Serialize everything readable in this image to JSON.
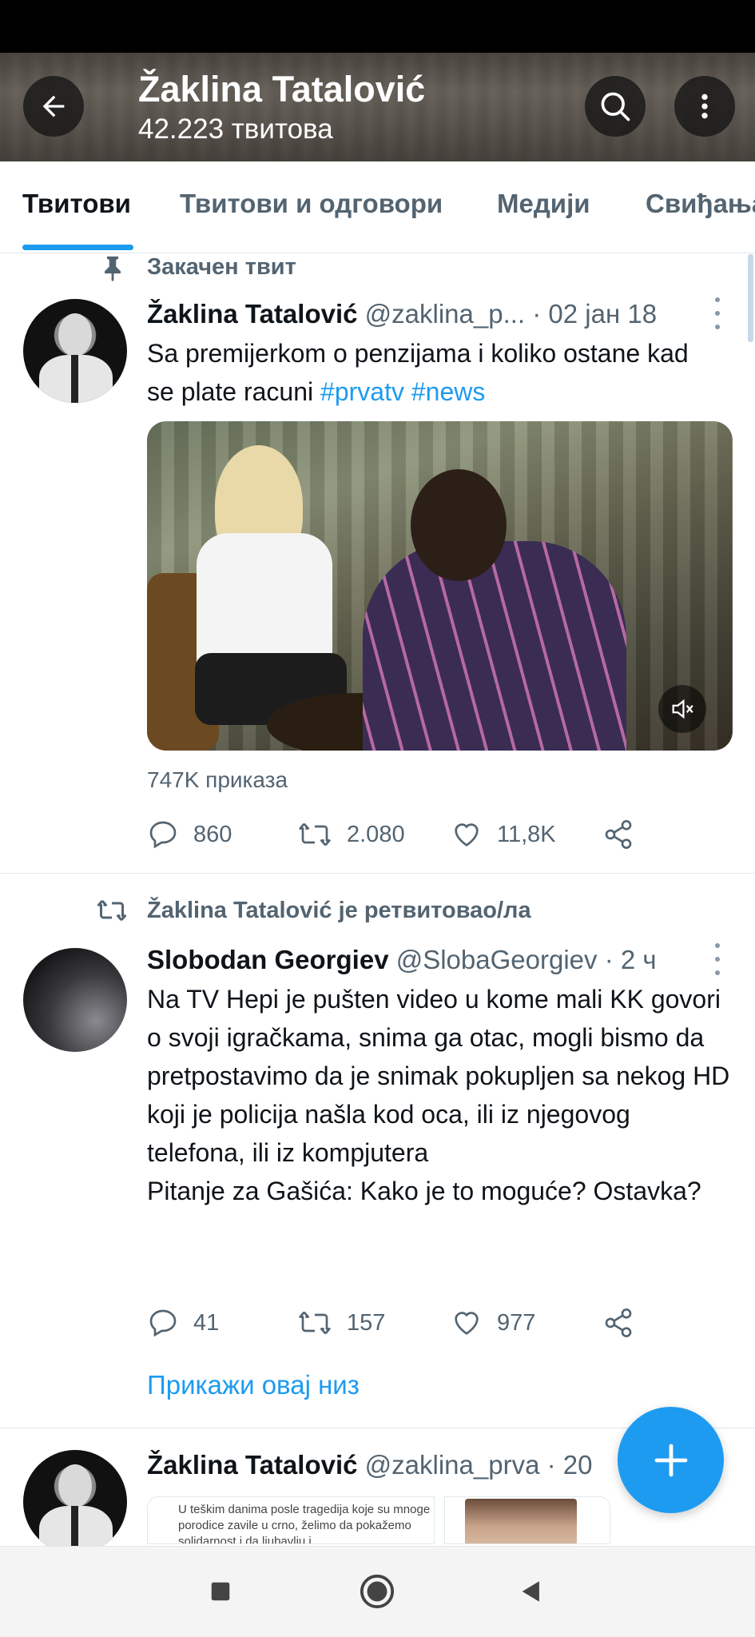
{
  "header": {
    "title": "Žaklina Tatalović",
    "subtitle": "42.223 твитова"
  },
  "tabs": [
    {
      "label": "Твитови",
      "active": true
    },
    {
      "label": "Твитови и одговори",
      "active": false
    },
    {
      "label": "Медији",
      "active": false
    },
    {
      "label": "Свиђања",
      "active": false
    }
  ],
  "tweets": [
    {
      "context": "Закачен твит",
      "author_name": "Žaklina Tatalović",
      "handle": "@zaklina_p...",
      "time": "· 02 јан 18",
      "text_before": "Sa premijerkom o penzijama i koliko ostane kad se plate racuni ",
      "hashtags": [
        "#prvatv",
        "#news"
      ],
      "views": "747K приказа",
      "replies": "860",
      "retweets": "2.080",
      "likes": "11,8K"
    },
    {
      "context": "Žaklina Tatalović је ретвитовао/ла",
      "author_name": "Slobodan Georgiev",
      "handle": "@SlobaGeorgiev",
      "time": "· 2 ч",
      "text": "Na TV Hepi je pušten video u kome mali KK govori o svoji igračkama, snima ga otac, mogli bismo da pretpostavimo da je snimak pokupljen sa nekog HD koji je policija našla kod oca, ili iz njegovog telefona, ili iz kompjutera\nPitanje za Gašića: Kako je to moguće? Ostavka?",
      "replies": "41",
      "retweets": "157",
      "likes": "977",
      "show_thread": "Прикажи овај низ"
    },
    {
      "author_name": "Žaklina Tatalović",
      "handle": "@zaklina_prva",
      "time": "· 20",
      "thumb_text": "U teškim danima posle tragedija koje su mnoge porodice zavile u crno, želimo da pokažemo solidarnost i da ljubavlju i"
    }
  ],
  "icons": {
    "back": "arrow-left-icon",
    "search": "search-icon",
    "more": "more-vertical-icon",
    "pin": "pin-icon",
    "retweet_context": "retweet-icon",
    "reply": "reply-icon",
    "retweet": "retweet-icon",
    "like": "heart-icon",
    "share": "share-icon",
    "mute": "volume-mute-icon",
    "compose": "plus-icon"
  },
  "colors": {
    "accent": "#1d9bf0",
    "text": "#0f1419",
    "muted": "#536471"
  }
}
